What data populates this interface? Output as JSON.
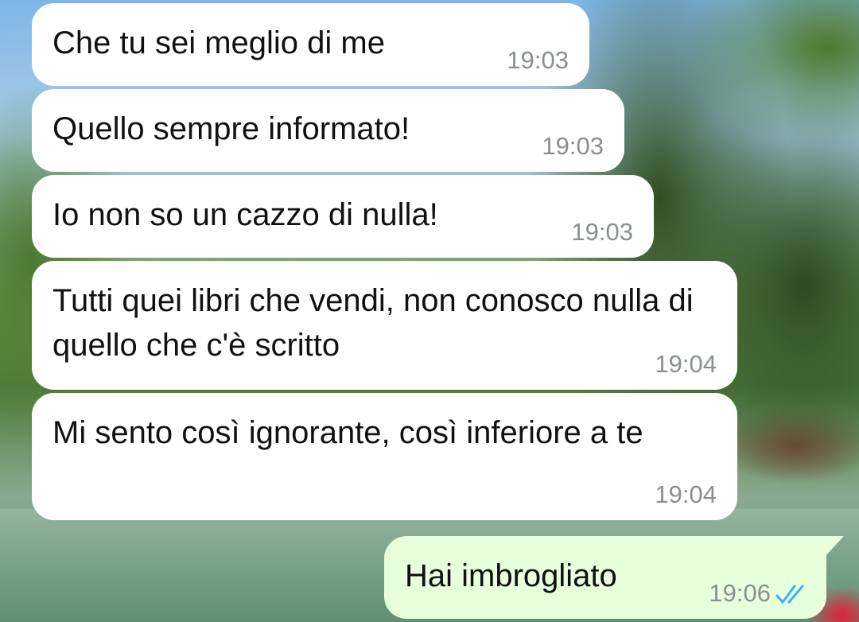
{
  "messages": [
    {
      "direction": "incoming",
      "text": "Che tu sei meglio di me",
      "time": "19:03"
    },
    {
      "direction": "incoming",
      "text": "Quello sempre informato!",
      "time": "19:03"
    },
    {
      "direction": "incoming",
      "text": "Io non so un cazzo di nulla!",
      "time": "19:03"
    },
    {
      "direction": "incoming",
      "text": "Tutti quei libri che vendi, non conosco nulla di quello che c'è scritto",
      "time": "19:04"
    },
    {
      "direction": "incoming",
      "text": "Mi sento così ignorante, così inferiore a te",
      "time": "19:04"
    },
    {
      "direction": "outgoing",
      "text": "Hai imbrogliato",
      "time": "19:06",
      "status_icon": "double-check-read-icon"
    }
  ],
  "colors": {
    "incoming_bubble": "#ffffff",
    "outgoing_bubble": "#e7ffdb",
    "timestamp": "#8a8f93",
    "read_ticks": "#34b7f1"
  }
}
